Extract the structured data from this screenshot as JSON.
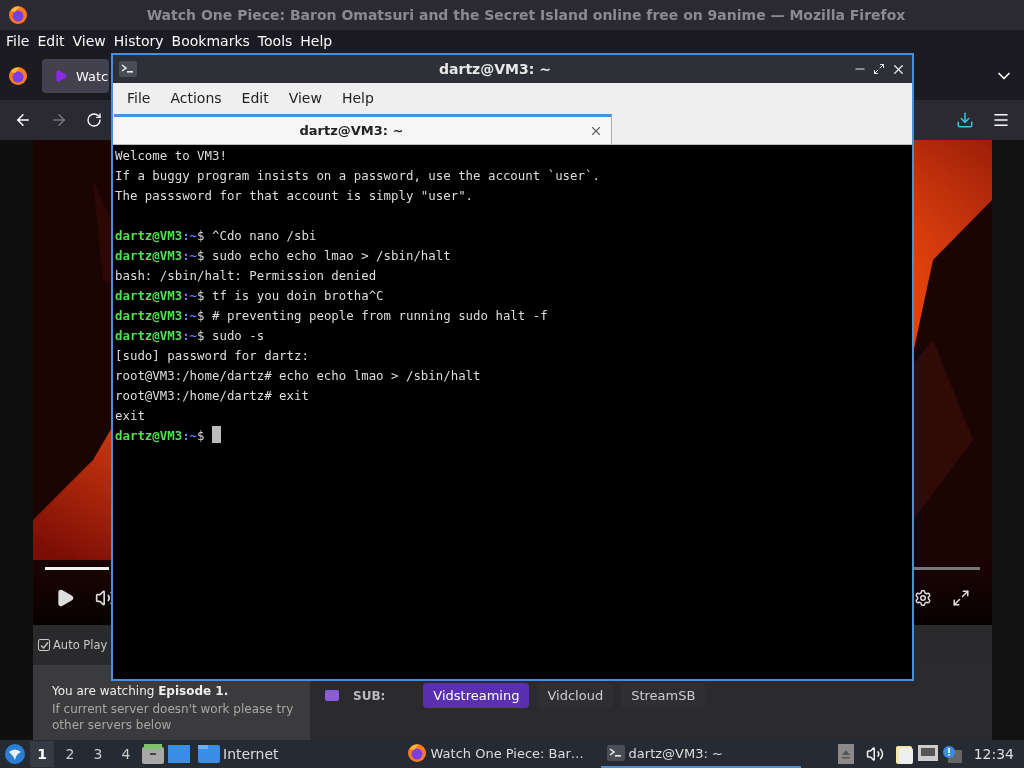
{
  "browser": {
    "title": "Watch One Piece: Baron Omatsuri and the Secret Island online free on 9anime — Mozilla Firefox",
    "menu": [
      "File",
      "Edit",
      "View",
      "History",
      "Bookmarks",
      "Tools",
      "Help"
    ],
    "tab": {
      "title": "Watc"
    },
    "autoplay": {
      "label": "Auto Play",
      "checked": true
    },
    "episode": {
      "heading": "You are watching **Episode 1.**",
      "note": "If current server doesn't work please try other servers below"
    },
    "servers": {
      "label": "SUB:",
      "items": [
        {
          "label": "Vidstreaming",
          "selected": true
        },
        {
          "label": "Vidcloud",
          "selected": false
        },
        {
          "label": "StreamSB",
          "selected": false
        }
      ]
    }
  },
  "terminal": {
    "title": "dartz@VM3: ~",
    "menu": [
      "File",
      "Actions",
      "Edit",
      "View",
      "Help"
    ],
    "tab": {
      "title": "dartz@VM3: ~"
    },
    "lines": [
      {
        "kind": "output",
        "text": "Welcome to VM3!"
      },
      {
        "kind": "output",
        "text": "If a buggy program insists on a password, use the account `user`."
      },
      {
        "kind": "output",
        "text": "The passsword for that account is simply \"user\"."
      },
      {
        "kind": "blank"
      },
      {
        "kind": "prompt",
        "user": "dartz@VM3",
        "path": ":~",
        "text": "$ ^Cdo nano /sbi"
      },
      {
        "kind": "prompt",
        "user": "dartz@VM3",
        "path": ":~",
        "text": "$ sudo echo echo lmao > /sbin/halt"
      },
      {
        "kind": "output",
        "text": "bash: /sbin/halt: Permission denied"
      },
      {
        "kind": "prompt",
        "user": "dartz@VM3",
        "path": ":~",
        "text": "$ tf is you doin brotha^C"
      },
      {
        "kind": "prompt",
        "user": "dartz@VM3",
        "path": ":~",
        "text": "$ # preventing people from running sudo halt -f"
      },
      {
        "kind": "prompt",
        "user": "dartz@VM3",
        "path": ":~",
        "text": "$ sudo -s"
      },
      {
        "kind": "output",
        "text": "[sudo] password for dartz:"
      },
      {
        "kind": "output",
        "text": "root@VM3:/home/dartz# echo echo lmao > /sbin/halt"
      },
      {
        "kind": "output",
        "text": "root@VM3:/home/dartz# exit"
      },
      {
        "kind": "output",
        "text": "exit"
      },
      {
        "kind": "prompt",
        "user": "dartz@VM3",
        "path": ":~",
        "text": "$ ",
        "cursor": true
      }
    ]
  },
  "taskbar": {
    "workspaces": [
      {
        "label": "1",
        "selected": true
      },
      {
        "label": "2",
        "selected": false
      },
      {
        "label": "3",
        "selected": false
      },
      {
        "label": "4",
        "selected": false
      }
    ],
    "launchers": [
      {
        "label": "Internet"
      }
    ],
    "tasks": [
      {
        "title": "Watch One Piece: Bar…",
        "selected": false,
        "kind": "browser"
      },
      {
        "title": "dartz@VM3: ~",
        "selected": true,
        "kind": "terminal"
      }
    ],
    "clock": "12:34"
  }
}
